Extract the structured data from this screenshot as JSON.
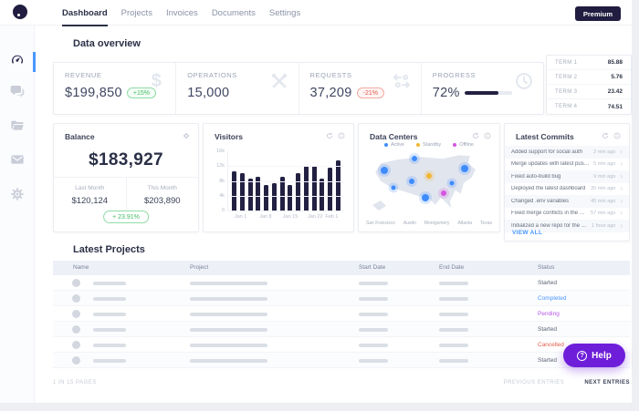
{
  "topbar": {
    "nav": [
      {
        "label": "Dashboard",
        "active": true
      },
      {
        "label": "Projects",
        "active": false
      },
      {
        "label": "Invoices",
        "active": false
      },
      {
        "label": "Documents",
        "active": false
      },
      {
        "label": "Settings",
        "active": false
      }
    ],
    "premium_label": "Premium"
  },
  "sidebar": {
    "items": [
      "dashboard",
      "chat",
      "folder",
      "mail",
      "settings"
    ],
    "active_item": "dashboard",
    "accent_color": "#4a97ff"
  },
  "overview": {
    "title": "Data overview",
    "stats": [
      {
        "label": "REVENUE",
        "value": "$199,850",
        "delta": "+15%",
        "delta_type": "up",
        "icon": "dollar-icon"
      },
      {
        "label": "OPERATIONS",
        "value": "15,000",
        "icon": "tools-icon"
      },
      {
        "label": "REQUESTS",
        "value": "37,209",
        "delta": "-21%",
        "delta_type": "down",
        "icon": "arrows-icon"
      },
      {
        "label": "PROGRESS",
        "value": "72%",
        "progress_pct": 72,
        "icon": "clock-icon"
      }
    ],
    "terms": [
      {
        "label": "TERM 1",
        "value": "85.88"
      },
      {
        "label": "TERM 2",
        "value": "5.76"
      },
      {
        "label": "TERM 3",
        "value": "23.42"
      },
      {
        "label": "TERM 4",
        "value": "74.51"
      }
    ]
  },
  "balance": {
    "title": "Balance",
    "value": "$183,927",
    "last_month_label": "Last Month",
    "last_month_value": "$120,124",
    "this_month_label": "This Month",
    "this_month_value": "$203,890",
    "delta": "+ 23.91%"
  },
  "chart_data": {
    "type": "bar",
    "title": "Visitors",
    "xlabel": "",
    "ylabel": "",
    "ylim": [
      0,
      16000
    ],
    "values_k": [
      10.5,
      10,
      8.5,
      9,
      7,
      7.5,
      9,
      7,
      10,
      12,
      12,
      8.5,
      11.5,
      13.5
    ],
    "ymax_k": 16,
    "yticks": [
      "16k",
      "12k",
      "8k",
      "4k",
      "0"
    ],
    "xticks": [
      {
        "label": "Jan 1",
        "bar_index": 1
      },
      {
        "label": "Jan 8",
        "bar_index": 4
      },
      {
        "label": "Jan 15",
        "bar_index": 7
      },
      {
        "label": "Jan 22",
        "bar_index": 10
      },
      {
        "label": "Feb 1",
        "bar_index": 12
      }
    ],
    "bar_color": "#232142",
    "grid": true,
    "legend_position": "none"
  },
  "data_centers": {
    "title": "Data Centers",
    "legend": [
      {
        "label": "Active",
        "color": "#3f8cff"
      },
      {
        "label": "Standby",
        "color": "#f2b632"
      },
      {
        "label": "Offline",
        "color": "#d554e0"
      }
    ],
    "cities": [
      "San Francisco",
      "Austin",
      "Montgomery",
      "Atlanta",
      "Texas"
    ],
    "dots": [
      {
        "x": 37,
        "y": 10,
        "color": "#3f8cff",
        "size": 6
      },
      {
        "x": 12,
        "y": 30,
        "color": "#3f8cff",
        "size": 8
      },
      {
        "x": 79,
        "y": 27,
        "color": "#3f8cff",
        "size": 8
      },
      {
        "x": 35,
        "y": 49,
        "color": "#3f8cff",
        "size": 6
      },
      {
        "x": 49,
        "y": 39,
        "color": "#f2b632",
        "size": 6
      },
      {
        "x": 20,
        "y": 59,
        "color": "#3f8cff",
        "size": 5
      },
      {
        "x": 68,
        "y": 51,
        "color": "#3f8cff",
        "size": 5
      },
      {
        "x": 61,
        "y": 68,
        "color": "#d554e0",
        "size": 6
      },
      {
        "x": 46,
        "y": 76,
        "color": "#3f8cff",
        "size": 8
      }
    ]
  },
  "commits": {
    "title": "Latest Commits",
    "view_all_label": "VIEW ALL",
    "items": [
      {
        "message": "Added support for social auth",
        "time": "2 min ago"
      },
      {
        "message": "Merge updates with latest push by ad...",
        "time": "5 min ago"
      },
      {
        "message": "Fixed auto-build bug",
        "time": "9 min ago"
      },
      {
        "message": "Deployed the latest dashboard",
        "time": "20 min ago"
      },
      {
        "message": "Changed .env variables",
        "time": "45 min ago"
      },
      {
        "message": "Fixed merge conflicts in the docs",
        "time": "57 min ago"
      },
      {
        "message": "Initialized a new repo for the chatbot",
        "time": "1 hour ago"
      }
    ]
  },
  "projects": {
    "title": "Latest Projects",
    "headers": [
      "Name",
      "Project",
      "Start Date",
      "End Date",
      "Status"
    ],
    "rows": [
      {
        "status": "Started",
        "status_color": "#5b6374"
      },
      {
        "status": "Completed",
        "status_color": "#4a97ff"
      },
      {
        "status": "Pending",
        "status_color": "#b557e8"
      },
      {
        "status": "Started",
        "status_color": "#5b6374"
      },
      {
        "status": "Cancelled",
        "status_color": "#e25c4a"
      },
      {
        "status": "Started",
        "status_color": "#5b6374"
      }
    ]
  },
  "pagination": {
    "pages_label": "1 IN 15 PAGES",
    "prev_label": "PREVIOUS ENTRIES",
    "next_label": "NEXT ENTRIES"
  },
  "help": {
    "label": "Help",
    "icon": "?"
  }
}
